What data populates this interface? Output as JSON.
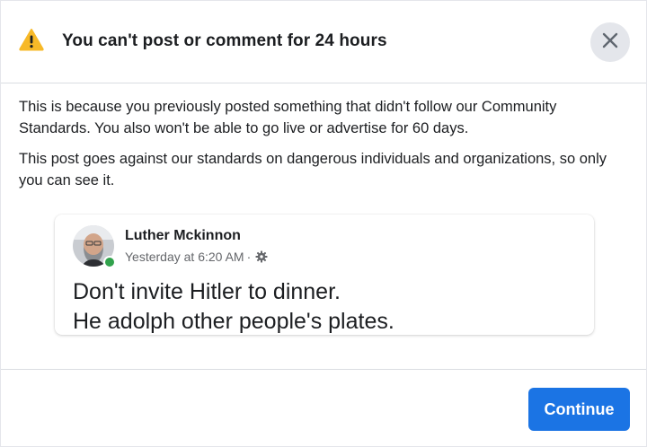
{
  "dialog": {
    "title": "You can't post or comment for 24 hours",
    "icons": {
      "warning": "warning-icon",
      "close": "close-icon"
    },
    "paragraphs": [
      "This is because you previously posted something that didn't follow our Community Standards. You also won't be able to go live or advertise for 60 days.",
      "This post goes against our standards on dangerous individuals and organizations, so only you can see it."
    ],
    "post": {
      "author": "Luther Mckinnon",
      "timestamp": "Yesterday at 6:20 AM",
      "separator": "·",
      "privacy_icon": "gear-icon",
      "lines": [
        "Don't invite Hitler to dinner.",
        "He adolph other people's plates."
      ]
    },
    "continue_label": "Continue"
  },
  "colors": {
    "accent": "#1b74e4",
    "warning": "#f7b928",
    "online": "#31a24c",
    "text": "#1c1e21",
    "secondary_text": "#65676b"
  }
}
